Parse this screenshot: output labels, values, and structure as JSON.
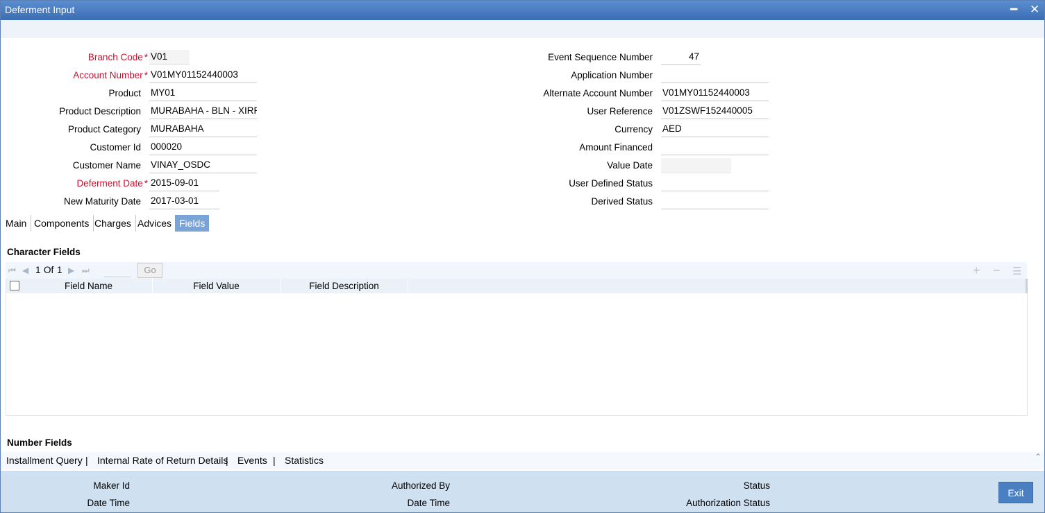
{
  "window": {
    "title": "Deferment Input"
  },
  "form": {
    "left": [
      {
        "label": "Branch Code",
        "required": true,
        "value": "V01"
      },
      {
        "label": "Account Number",
        "required": true,
        "value": "V01MY01152440003"
      },
      {
        "label": "Product",
        "required": false,
        "value": "MY01"
      },
      {
        "label": "Product Description",
        "required": false,
        "value": "MURABAHA - BLN - XIRR"
      },
      {
        "label": "Product Category",
        "required": false,
        "value": "MURABAHA"
      },
      {
        "label": "Customer Id",
        "required": false,
        "value": "000020"
      },
      {
        "label": "Customer Name",
        "required": false,
        "value": "VINAY_OSDC"
      },
      {
        "label": "Deferment Date",
        "required": true,
        "value": "2015-09-01"
      },
      {
        "label": "New Maturity Date",
        "required": false,
        "value": "2017-03-01"
      }
    ],
    "right": [
      {
        "label": "Event Sequence Number",
        "value": "47"
      },
      {
        "label": "Application Number",
        "value": ""
      },
      {
        "label": "Alternate Account Number",
        "value": "V01MY01152440003"
      },
      {
        "label": "User Reference",
        "value": "V01ZSWF152440005"
      },
      {
        "label": "Currency",
        "value": "AED"
      },
      {
        "label": "Amount Financed",
        "value": ""
      },
      {
        "label": "Value Date",
        "value": ""
      },
      {
        "label": "User Defined Status",
        "value": ""
      },
      {
        "label": "Derived Status",
        "value": ""
      }
    ]
  },
  "tabs": [
    "Main",
    "Components",
    "Charges",
    "Advices",
    "Fields"
  ],
  "active_tab": "Fields",
  "character_fields": {
    "title": "Character Fields",
    "pagination": {
      "current": "1",
      "of_label": "Of",
      "total": "1",
      "go_label": "Go"
    },
    "columns": [
      "Field Name",
      "Field Value",
      "Field Description"
    ],
    "rows": []
  },
  "number_fields": {
    "title": "Number Fields"
  },
  "links": [
    "Installment Query",
    "Internal Rate of Return Details",
    "Events",
    "Statistics"
  ],
  "footer": {
    "maker_id": "Maker Id",
    "maker_date_time": "Date Time",
    "authorized_by": "Authorized By",
    "auth_date_time": "Date Time",
    "status": "Status",
    "authorization_status": "Authorization Status",
    "exit_label": "Exit"
  }
}
